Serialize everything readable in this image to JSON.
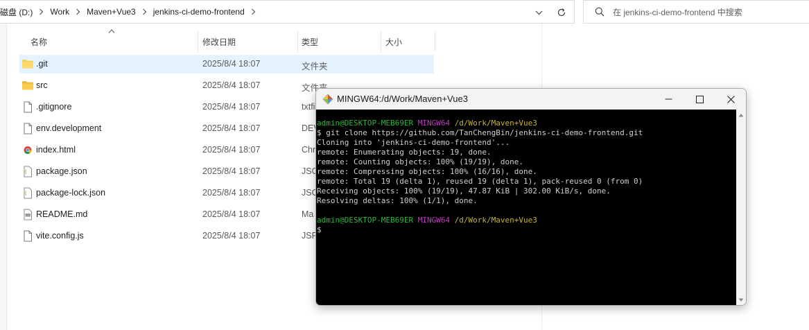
{
  "explorer": {
    "breadcrumb": [
      "磁盘 (D:)",
      "Work",
      "Maven+Vue3",
      "jenkins-ci-demo-frontend"
    ],
    "search": {
      "placeholder": "在 jenkins-ci-demo-frontend 中搜索"
    },
    "columns": {
      "name": "名称",
      "date": "修改日期",
      "type": "类型",
      "size": "大小"
    },
    "files": [
      {
        "name": ".git",
        "date": "2025/8/4 18:07",
        "type": "文件夹",
        "icon": "folder-icon",
        "selected": true
      },
      {
        "name": "src",
        "date": "2025/8/4 18:07",
        "type": "文件夹",
        "icon": "folder-icon",
        "selected": false
      },
      {
        "name": ".gitignore",
        "date": "2025/8/4 18:07",
        "type": "txtfi",
        "icon": "file-icon",
        "selected": false
      },
      {
        "name": "env.development",
        "date": "2025/8/4 18:07",
        "type": "DEV",
        "icon": "file-icon",
        "selected": false
      },
      {
        "name": "index.html",
        "date": "2025/8/4 18:07",
        "type": "Chr",
        "icon": "chrome-html-icon",
        "selected": false
      },
      {
        "name": "package.json",
        "date": "2025/8/4 18:07",
        "type": "JSO",
        "icon": "json-file-icon",
        "selected": false
      },
      {
        "name": "package-lock.json",
        "date": "2025/8/4 18:07",
        "type": "JSO",
        "icon": "json-file-icon",
        "selected": false
      },
      {
        "name": "README.md",
        "date": "2025/8/4 18:07",
        "type": "Ma",
        "icon": "markdown-file-icon",
        "selected": false
      },
      {
        "name": "vite.config.js",
        "date": "2025/8/4 18:07",
        "type": "JSFi",
        "icon": "file-icon",
        "selected": false
      }
    ]
  },
  "terminal": {
    "title": "MINGW64:/d/Work/Maven+Vue3",
    "prompt1": {
      "user": "admin@DESKTOP-MEB69ER",
      "env": "MINGW64",
      "path": "/d/Work/Maven+Vue3"
    },
    "lines": [
      "$ git clone https://github.com/TanChengBin/jenkins-ci-demo-frontend.git",
      "Cloning into 'jenkins-ci-demo-frontend'...",
      "remote: Enumerating objects: 19, done.",
      "remote: Counting objects: 100% (19/19), done.",
      "remote: Compressing objects: 100% (16/16), done.",
      "remote: Total 19 (delta 1), reused 19 (delta 1), pack-reused 0 (from 0)",
      "Receiving objects: 100% (19/19), 47.87 KiB | 302.00 KiB/s, done.",
      "Resolving deltas: 100% (1/1), done."
    ],
    "prompt2": {
      "user": "admin@DESKTOP-MEB69ER",
      "env": "MINGW64",
      "path": "/d/Work/Maven+Vue3"
    },
    "cursor_line": "$"
  }
}
